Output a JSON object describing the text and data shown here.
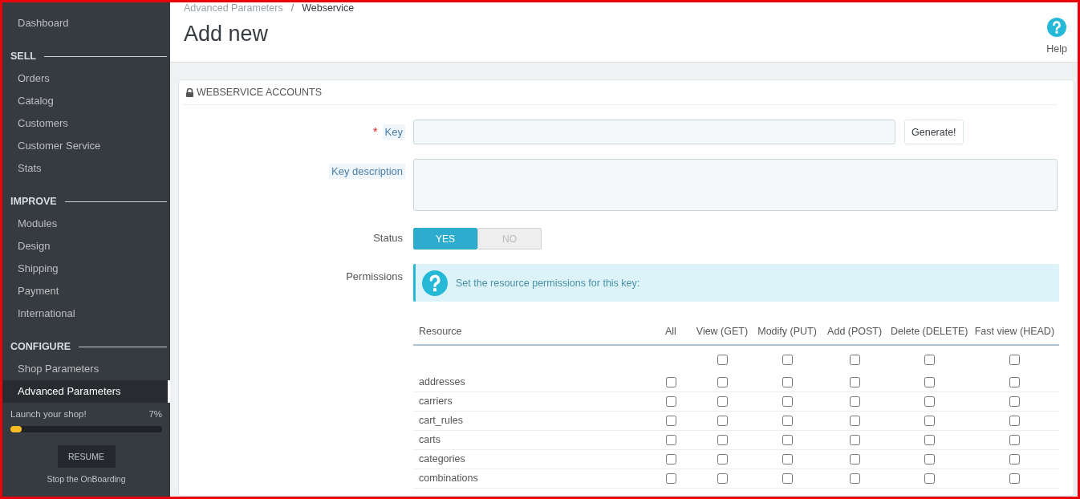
{
  "sidebar": {
    "items": [
      {
        "label": "Dashboard",
        "selected": false
      }
    ],
    "sections": [
      {
        "title": "SELL",
        "items": [
          {
            "label": "Orders",
            "selected": false
          },
          {
            "label": "Catalog",
            "selected": false
          },
          {
            "label": "Customers",
            "selected": false
          },
          {
            "label": "Customer Service",
            "selected": false
          },
          {
            "label": "Stats",
            "selected": false
          }
        ]
      },
      {
        "title": "IMPROVE",
        "items": [
          {
            "label": "Modules",
            "selected": false
          },
          {
            "label": "Design",
            "selected": false
          },
          {
            "label": "Shipping",
            "selected": false
          },
          {
            "label": "Payment",
            "selected": false
          },
          {
            "label": "International",
            "selected": false
          }
        ]
      },
      {
        "title": "CONFIGURE",
        "items": [
          {
            "label": "Shop Parameters",
            "selected": false
          },
          {
            "label": "Advanced Parameters",
            "selected": true
          }
        ]
      }
    ],
    "onboarding": {
      "label": "Launch your shop!",
      "percent": "7%",
      "level": 0.07,
      "button": "RESUME",
      "stop_link": "Stop the OnBoarding"
    }
  },
  "breadcrumb": {
    "items": [
      "Advanced Parameters",
      "Webservice"
    ],
    "separator": "/"
  },
  "page_title": "Add new",
  "help": {
    "label": "Help"
  },
  "panel": {
    "title": "WEBSERVICE ACCOUNTS",
    "key": {
      "label": "Key",
      "required_mark": "*",
      "button": "Generate!"
    },
    "key_description": {
      "label": "Key description"
    },
    "status": {
      "label": "Status",
      "options": [
        {
          "label": "YES",
          "selected": true
        },
        {
          "label": "NO",
          "selected": false
        }
      ]
    },
    "permissions": {
      "label": "Permissions",
      "info": "Set the resource permissions for this key:",
      "columns": [
        "Resource",
        "All",
        "View (GET)",
        "Modify (PUT)",
        "Add (POST)",
        "Delete (DELETE)",
        "Fast view (HEAD)"
      ],
      "select_all": [
        {
          "checked": false
        },
        {
          "checked": false
        },
        {
          "checked": false
        },
        {
          "checked": false
        },
        {
          "checked": false
        }
      ],
      "rows": [
        {
          "name": "addresses",
          "checks": [
            {
              "checked": false
            },
            {
              "checked": false
            },
            {
              "checked": false
            },
            {
              "checked": false
            },
            {
              "checked": false
            },
            {
              "checked": false
            }
          ]
        },
        {
          "name": "carriers",
          "checks": [
            {
              "checked": false
            },
            {
              "checked": false
            },
            {
              "checked": false
            },
            {
              "checked": false
            },
            {
              "checked": false
            },
            {
              "checked": false
            }
          ]
        },
        {
          "name": "cart_rules",
          "checks": [
            {
              "checked": false
            },
            {
              "checked": false
            },
            {
              "checked": false
            },
            {
              "checked": false
            },
            {
              "checked": false
            },
            {
              "checked": false
            }
          ]
        },
        {
          "name": "carts",
          "checks": [
            {
              "checked": false
            },
            {
              "checked": false
            },
            {
              "checked": false
            },
            {
              "checked": false
            },
            {
              "checked": false
            },
            {
              "checked": false
            }
          ]
        },
        {
          "name": "categories",
          "checks": [
            {
              "checked": false
            },
            {
              "checked": false
            },
            {
              "checked": false
            },
            {
              "checked": false
            },
            {
              "checked": false
            },
            {
              "checked": false
            }
          ]
        },
        {
          "name": "combinations",
          "checks": [
            {
              "checked": false
            },
            {
              "checked": false
            },
            {
              "checked": false
            },
            {
              "checked": false
            },
            {
              "checked": false
            },
            {
              "checked": false
            }
          ]
        }
      ]
    }
  }
}
